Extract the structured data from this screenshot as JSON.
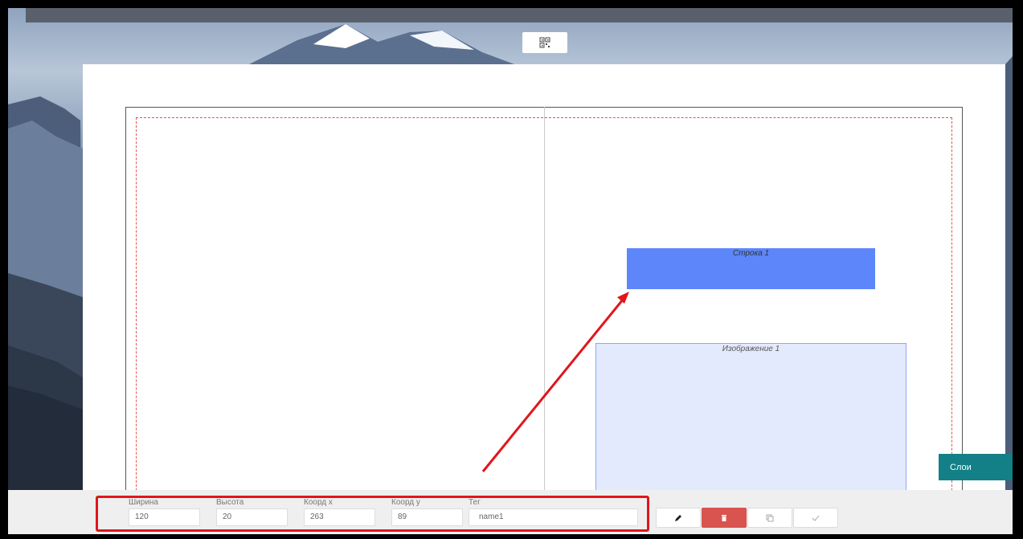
{
  "toolbar_top": {
    "icon": "qr-code-icon"
  },
  "canvas": {
    "elements": [
      {
        "label": "Строка 1",
        "kind": "text-line",
        "color": "#5c86f9"
      },
      {
        "label": "Изображение 1",
        "kind": "image",
        "color": "#e4eafd"
      }
    ]
  },
  "layers_button": {
    "label": "Слои",
    "color": "#137f86"
  },
  "properties": {
    "width_label": "Ширина",
    "width_value": "120",
    "height_label": "Высота",
    "height_value": "20",
    "x_label": "Коорд x",
    "x_value": "263",
    "y_label": "Коорд y",
    "y_value": "89",
    "tag_label": "Тег",
    "tag_value": "name1"
  },
  "actions": [
    {
      "name": "edit",
      "icon": "pencil-icon"
    },
    {
      "name": "delete",
      "icon": "trash-icon",
      "color": "#d9534f"
    },
    {
      "name": "duplicate",
      "icon": "copy-icon"
    },
    {
      "name": "confirm",
      "icon": "check-icon"
    }
  ],
  "colors": {
    "highlight": "#e0161c",
    "arrow": "#e0161c",
    "margin": "#e5524a"
  }
}
